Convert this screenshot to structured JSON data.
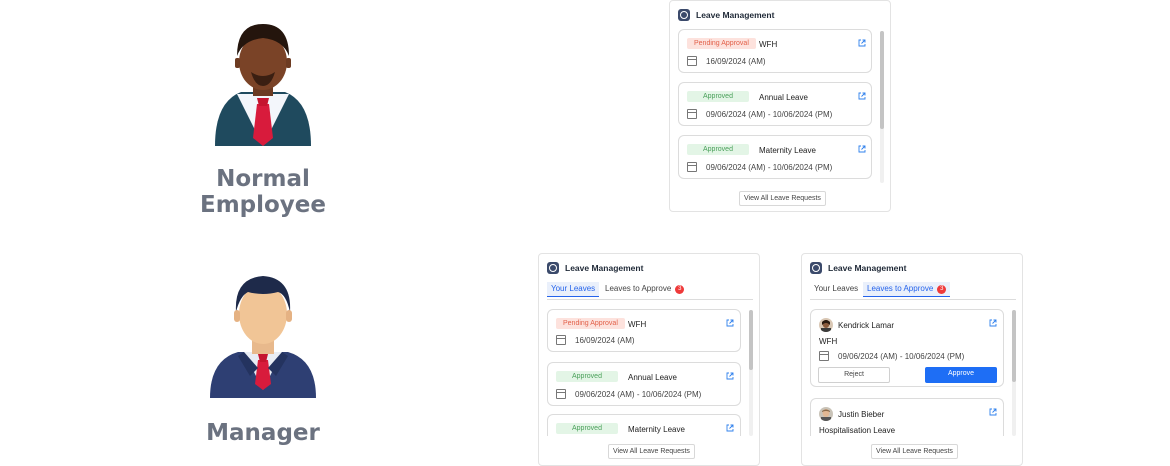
{
  "roles": {
    "employee_label": "Normal Employee",
    "manager_label": "Manager"
  },
  "employee_card": {
    "title": "Leave Management",
    "items": [
      {
        "status": "Pending Approval",
        "type": "WFH",
        "date": "16/09/2024 (AM)"
      },
      {
        "status": "Approved",
        "type": "Annual Leave",
        "date": "09/06/2024 (AM) - 10/06/2024 (PM)"
      },
      {
        "status": "Approved",
        "type": "Maternity Leave",
        "date": "09/06/2024 (AM) - 10/06/2024 (PM)"
      }
    ],
    "view_all": "View All Leave Requests"
  },
  "manager_card_your": {
    "title": "Leave Management",
    "tabs": {
      "your": "Your Leaves",
      "approve": "Leaves to Approve",
      "count": "3"
    },
    "items": [
      {
        "status": "Pending Approval",
        "type": "WFH",
        "date": "16/09/2024 (AM)"
      },
      {
        "status": "Approved",
        "type": "Annual Leave",
        "date": "09/06/2024 (AM) - 10/06/2024 (PM)"
      },
      {
        "status": "Approved",
        "type": "Maternity Leave"
      }
    ],
    "view_all": "View All Leave Requests"
  },
  "manager_card_approve": {
    "title": "Leave Management",
    "tabs": {
      "your": "Your Leaves",
      "approve": "Leaves to Approve",
      "count": "3"
    },
    "requests": [
      {
        "name": "Kendrick Lamar",
        "type": "WFH",
        "date": "09/06/2024 (AM) - 10/06/2024 (PM)",
        "reject": "Reject",
        "approve": "Approve"
      },
      {
        "name": "Justin Bieber",
        "type": "Hospitalisation Leave"
      }
    ],
    "view_all": "View All Leave Requests"
  },
  "colors": {
    "accent": "#1e6ef5",
    "pending": "#e2614a",
    "approved": "#4aa05a",
    "label": "#6b7280"
  }
}
